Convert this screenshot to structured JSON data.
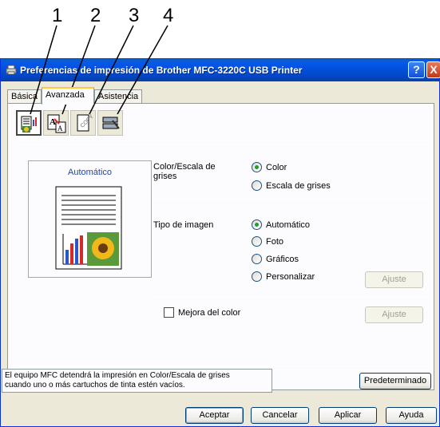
{
  "callouts": [
    "1",
    "2",
    "3",
    "4"
  ],
  "window": {
    "title": "Preferencias de impresión de Brother MFC-3220C USB Printer",
    "help_button": "?",
    "close_button": "X"
  },
  "tabs": [
    {
      "label": "Básica"
    },
    {
      "label": "Avanzada"
    },
    {
      "label": "Asistencia"
    }
  ],
  "toolbar": {
    "buttons": [
      {
        "icon": "color-settings-icon"
      },
      {
        "icon": "scaling-icon"
      },
      {
        "icon": "watermark-icon"
      },
      {
        "icon": "device-options-icon"
      }
    ]
  },
  "preview": {
    "label": "Automático"
  },
  "color_section": {
    "label": "Color/Escala de grises",
    "options": [
      "Color",
      "Escala de grises"
    ],
    "selected": "Color"
  },
  "image_type": {
    "label": "Tipo de imagen",
    "options": [
      "Automático",
      "Foto",
      "Gráficos",
      "Personalizar"
    ],
    "selected": "Automático",
    "adjust_button": "Ajuste"
  },
  "color_enhancement": {
    "label": "Mejora del color",
    "checked": false,
    "adjust_button": "Ajuste"
  },
  "status_text": {
    "line1": "El equipo MFC detendrá la impresión en Color/Escala de grises",
    "line2": "cuando uno o más cartuchos de tinta estén vacíos."
  },
  "default_button": "Predeterminado",
  "footer": {
    "ok": "Aceptar",
    "cancel": "Cancelar",
    "apply": "Aplicar",
    "help": "Ayuda"
  }
}
